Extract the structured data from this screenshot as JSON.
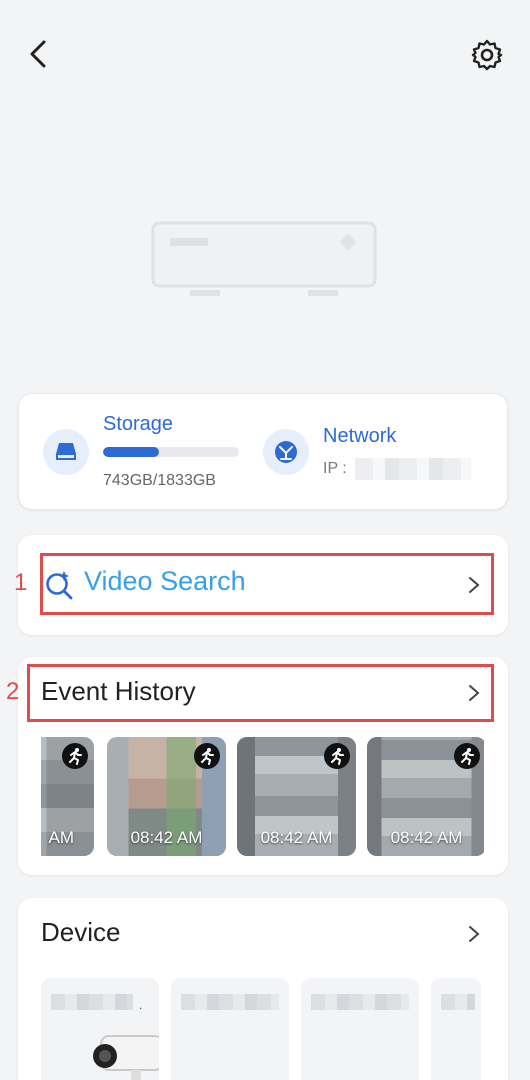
{
  "header": {
    "back_icon": "chevron-left-icon",
    "settings_icon": "gear-icon"
  },
  "status": {
    "storage": {
      "title": "Storage",
      "used_fraction": 0.41,
      "text": "743GB/1833GB",
      "icon": "drive-icon"
    },
    "network": {
      "title": "Network",
      "ip_label": "IP :",
      "icon": "network-icon"
    }
  },
  "search": {
    "label": "Video Search",
    "icon": "search-icon"
  },
  "events": {
    "label": "Event History",
    "thumbnails": [
      {
        "time": "AM"
      },
      {
        "time": "08:42 AM"
      },
      {
        "time": "08:42 AM"
      },
      {
        "time": "08:42 AM"
      }
    ]
  },
  "device": {
    "label": "Device"
  },
  "annotations": {
    "marker_1": "1",
    "marker_2": "2"
  },
  "colors": {
    "accent": "#2d6ad6",
    "search_text": "#35a0ee",
    "highlight": "#e04b4b"
  }
}
